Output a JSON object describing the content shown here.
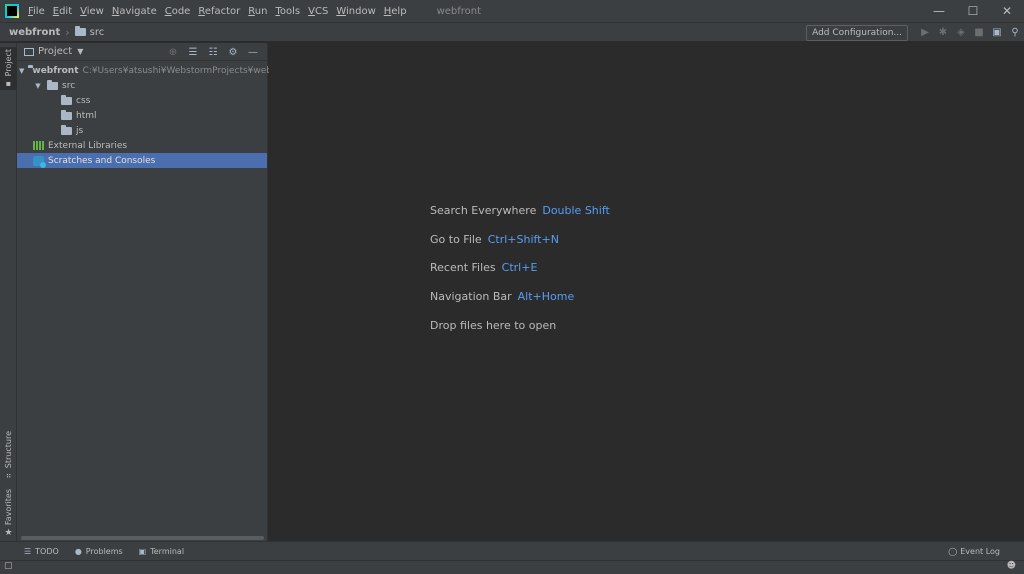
{
  "menu": {
    "items": [
      "File",
      "Edit",
      "View",
      "Navigate",
      "Code",
      "Refactor",
      "Run",
      "Tools",
      "VCS",
      "Window",
      "Help"
    ],
    "project_title": "webfront"
  },
  "window_controls": {
    "minimize": "—",
    "maximize": "☐",
    "close": "✕"
  },
  "navbar": {
    "root": "webfront",
    "folder": "src",
    "add_config": "Add Configuration..."
  },
  "left_stripe": {
    "project": "Project",
    "structure": "Structure",
    "favorites": "Favorites"
  },
  "project_panel": {
    "title": "Project",
    "tree": {
      "root_name": "webfront",
      "root_path": "C:¥Users¥atsushi¥WebstormProjects¥webfront",
      "src": "src",
      "css": "css",
      "html": "html",
      "js": "js",
      "external_libraries": "External Libraries",
      "scratches": "Scratches and Consoles"
    }
  },
  "editor": {
    "hints": [
      {
        "label": "Search Everywhere",
        "shortcut": "Double Shift"
      },
      {
        "label": "Go to File",
        "shortcut": "Ctrl+Shift+N"
      },
      {
        "label": "Recent Files",
        "shortcut": "Ctrl+E"
      },
      {
        "label": "Navigation Bar",
        "shortcut": "Alt+Home"
      }
    ],
    "drop_text": "Drop files here to open"
  },
  "bottom": {
    "todo": "TODO",
    "problems": "Problems",
    "terminal": "Terminal",
    "event_log": "Event Log"
  },
  "colors": {
    "accent": "#589df6",
    "selection": "#4b6eaf",
    "panel_bg": "#3c3f41",
    "editor_bg": "#2b2b2b"
  }
}
